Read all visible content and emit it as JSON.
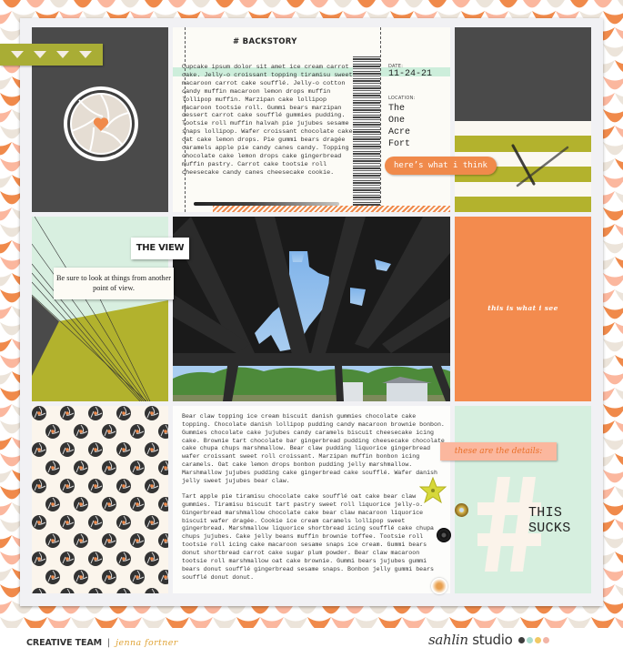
{
  "colors": {
    "orange": "#f08a4b",
    "peach": "#fbb79e",
    "cream": "#ece4da",
    "charcoal": "#4a4a4a",
    "olive": "#b3b22d",
    "mint": "#d8efe0",
    "gold": "#e0a437"
  },
  "backstory": {
    "title": "# BACKSTORY",
    "body": "Cupcake ipsum dolor sit amet ice cream carrot cake. Jelly-o croissant topping tiramisu sweet macaroon carrot cake soufflé. Jelly-o cotton candy muffin macaroon lemon drops muffin lollipop muffin. Marzipan cake lollipop macaroon tootsie roll. Gummi bears marzipan dessert carrot cake soufflé gummies pudding. Tootsie roll muffin halvah pie jujubes sesame snaps lollipop. Wafer croissant chocolate cake oat cake lemon drops. Pie gummi bears dragée caramels apple pie candy canes candy. Topping chocolate cake lemon drops cake gingerbread muffin pastry. Carrot cake tootsie roll cheesecake candy canes cheesecake cookie.",
    "date_label": "DATE:",
    "date_value": "11-24-21",
    "location_label": "LOCATION:",
    "location_lines": [
      "The",
      "One",
      "Acre",
      "Fort"
    ]
  },
  "labels": {
    "think": "here’s what i think",
    "view_title": "THE VIEW",
    "view_note": "Be sure to look at things from another point of view.",
    "see": "this is what i see",
    "details": "these are the details:",
    "sucks_line1": "THIS",
    "sucks_line2": "SUCKS"
  },
  "story": {
    "para1": "Bear claw topping ice cream biscuit danish gummies chocolate cake topping. Chocolate danish lollipop pudding candy macaroon brownie bonbon. Gummies chocolate cake jujubes candy caramels biscuit cheesecake icing cake. Brownie tart chocolate bar gingerbread pudding cheesecake chocolate cake chupa chups marshmallow. Bear claw pudding liquorice gingerbread wafer croissant sweet roll croissant. Marzipan muffin bonbon icing caramels. Oat cake lemon drops bonbon pudding jelly marshmallow. Marshmallow jujubes pudding cake gingerbread cake soufflé. Wafer danish jelly sweet jujubes bear claw.",
    "para2": "Tart apple pie tiramisu chocolate cake soufflé oat cake bear claw gummies. Tiramisu biscuit tart pastry sweet roll liquorice jelly-o. Gingerbread marshmallow chocolate cake bear claw macaroon liquorice biscuit wafer dragée. Cookie ice cream caramels lollipop sweet gingerbread. Marshmallow liquorice shortbread icing soufflé cake chupa chups jujubes. Cake jelly beans muffin brownie toffee. Tootsie roll tootsie roll icing cake macaroon sesame snaps ice cream. Gummi bears donut shortbread carrot cake sugar plum powder. Bear claw macaroon tootsie roll marshmallow oat cake brownie. Gummi bears jujubes gummi bears donut soufflé gingerbread sesame snaps. Bonbon jelly gummi bears soufflé donut donut."
  },
  "photo": {
    "description": "Looking up through the burnt roof beams of a fort at blue sky, with green trees and small sheds in the distance"
  },
  "footer": {
    "team_label": "CREATIVE TEAM",
    "separator": "|",
    "designer": "jenna fortner",
    "brand_script": "sahlin",
    "brand_word": "studio",
    "brand_dots": [
      "#3d3d3d",
      "#a9dccd",
      "#f1c964",
      "#f2b4a6"
    ]
  }
}
